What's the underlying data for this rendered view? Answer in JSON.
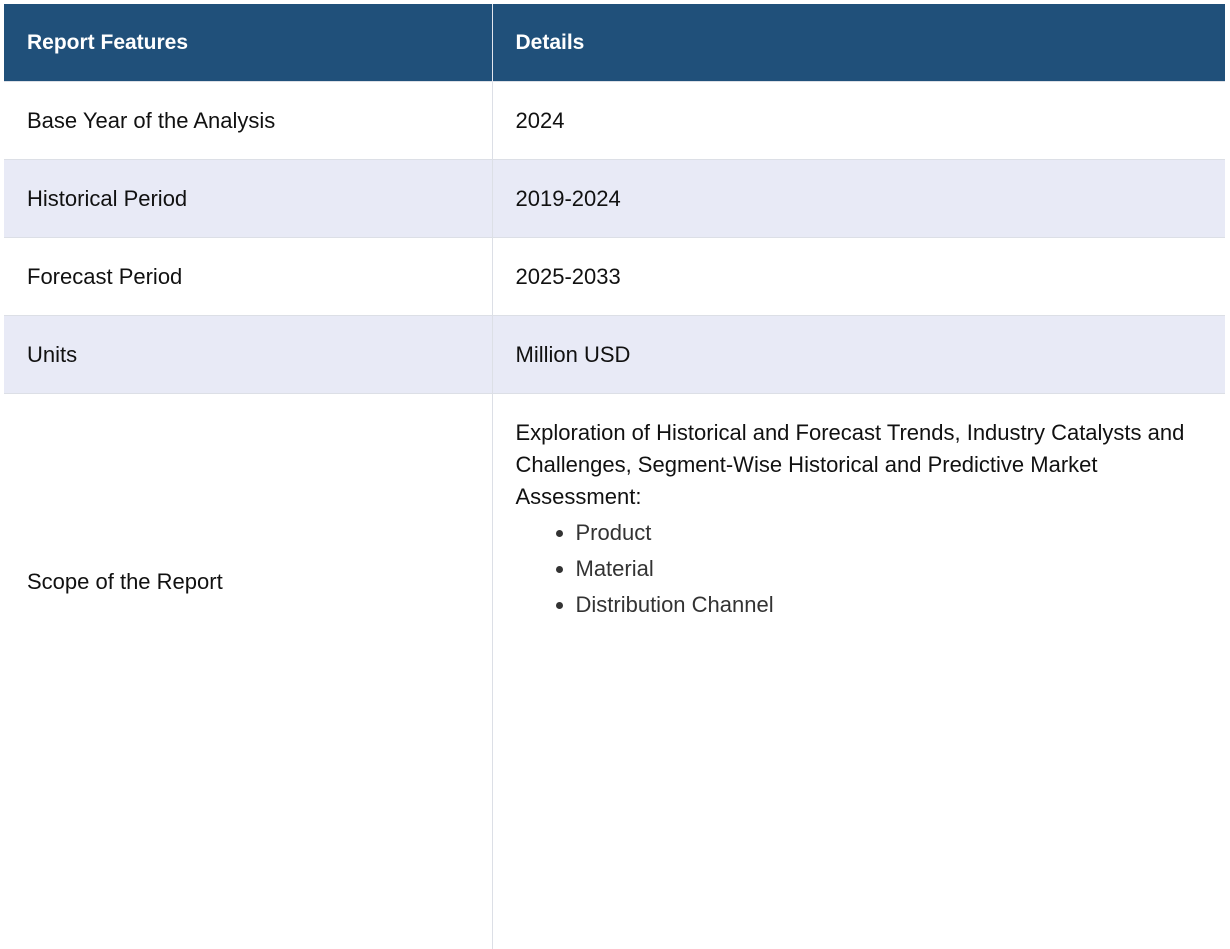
{
  "header": {
    "col1": "Report Features",
    "col2": "Details"
  },
  "rows": [
    {
      "feature": "Base Year of the Analysis",
      "detail": "2024"
    },
    {
      "feature": "Historical Period",
      "detail": "2019-2024"
    },
    {
      "feature": "Forecast Period",
      "detail": "2025-2033"
    },
    {
      "feature": "Units",
      "detail": "Million USD"
    }
  ],
  "scope": {
    "feature": "Scope of the Report",
    "intro": "Exploration of Historical and Forecast Trends, Industry Catalysts and Challenges, Segment-Wise Historical and Predictive Market Assessment:",
    "items": [
      "Product",
      "Material",
      "Distribution Channel"
    ]
  },
  "colors": {
    "header_bg": "#20507a",
    "alt_row_bg": "#e8eaf6"
  }
}
